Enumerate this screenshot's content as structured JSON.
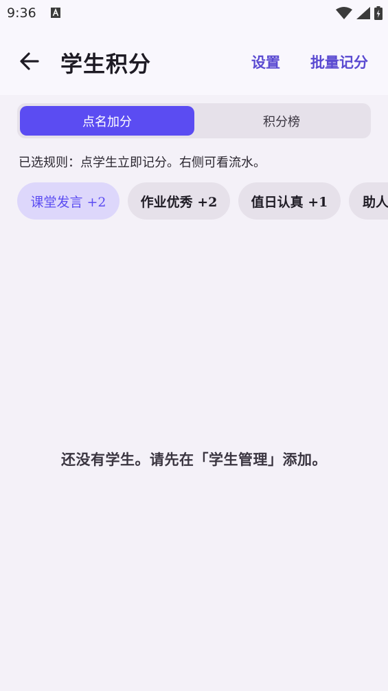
{
  "status_bar": {
    "time": "9:36"
  },
  "app_bar": {
    "title": "学生积分",
    "actions": {
      "settings": "设置",
      "batch": "批量记分"
    }
  },
  "tabs": [
    {
      "label": "点名加分",
      "selected": true
    },
    {
      "label": "积分榜",
      "selected": false
    }
  ],
  "rule_hint": "已选规则：点学生立即记分。右侧可看流水。",
  "rules": [
    {
      "label": "课堂发言 +2",
      "selected": true
    },
    {
      "label": "作业优秀 +2",
      "selected": false
    },
    {
      "label": "值日认真 +1",
      "selected": false
    },
    {
      "label": "助人",
      "selected": false
    }
  ],
  "empty_state": "还没有学生。请先在「学生管理」添加。",
  "colors": {
    "accent": "#5b4cf2",
    "accent_text": "#5a4ad1",
    "chip_bg": "#e6e1ea",
    "chip_selected_bg": "#ddd7fb",
    "background": "#f4f1f8",
    "app_bar_bg": "#f9f7fd"
  },
  "icons": {
    "back": "arrow-left-icon",
    "wifi": "wifi-icon",
    "signal": "signal-icon",
    "battery": "battery-charging-icon",
    "notification": "text-a-icon"
  }
}
